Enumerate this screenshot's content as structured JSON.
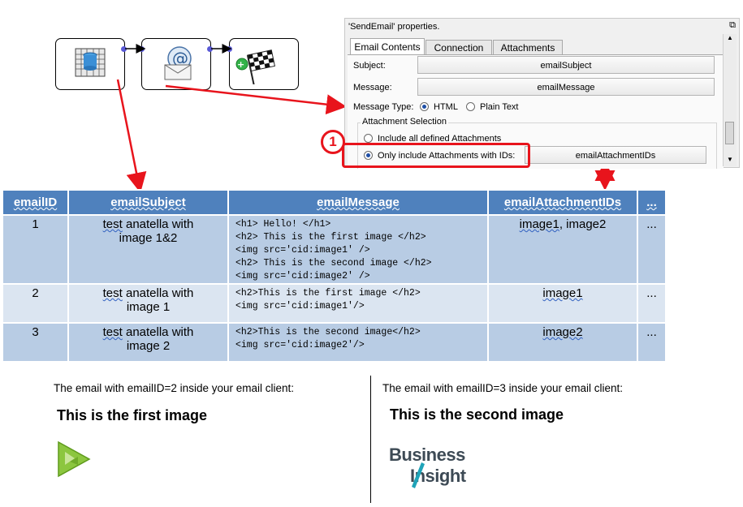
{
  "workflow": {
    "nodes": [
      {
        "name": "database-table",
        "icon": "table-database-icon"
      },
      {
        "name": "send-email",
        "icon": "email-icon"
      },
      {
        "name": "finish",
        "icon": "checkered-flag-icon"
      }
    ]
  },
  "properties": {
    "title": "'SendEmail' properties.",
    "tabs": [
      "Email Contents",
      "Connection",
      "Attachments"
    ],
    "subject_label": "Subject:",
    "subject_value": "emailSubject",
    "message_label": "Message:",
    "message_value": "emailMessage",
    "message_type_label": "Message Type:",
    "message_type_html": "HTML",
    "message_type_plain": "Plain Text",
    "attachment_group_label": "Attachment Selection",
    "attach_all_label": "Include all defined Attachments",
    "attach_ids_label": "Only include Attachments with IDs:",
    "attach_ids_value": "emailAttachmentIDs",
    "callout_number": "1"
  },
  "table": {
    "headers": [
      "emailID",
      "emailSubject",
      "emailMessage",
      "emailAttachmentIDs",
      "..."
    ],
    "rows": [
      {
        "id": "1",
        "subject_a": "test",
        "subject_b": " anatella with",
        "subject_c": "image 1&2",
        "message": [
          "<h1> Hello! </h1>",
          "<h2> This is the first image </h2>",
          "<img src='cid:image1' />",
          "<h2> This is the second image </h2>",
          "<img src='cid:image2' />"
        ],
        "attach_a": "image1",
        "attach_b": ", image2",
        "more": "..."
      },
      {
        "id": "2",
        "subject_a": "test",
        "subject_b": " anatella with",
        "subject_c": "image 1",
        "message": [
          "<h2>This is the first image </h2>",
          "<img src='cid:image1'/>"
        ],
        "attach_a": "image1",
        "more": "..."
      },
      {
        "id": "3",
        "subject_a": "test",
        "subject_b": " anatella with",
        "subject_c": "image 2",
        "message": [
          "<h2>This is the second image</h2>",
          "<img src='cid:image2'/>"
        ],
        "attach_a": "image2",
        "more": "..."
      }
    ]
  },
  "preview": {
    "left_caption": "The email with emailID=2 inside your email client:",
    "left_heading": "This is the first image",
    "left_image": "anatella-logo-icon",
    "right_caption": "The email with emailID=3 inside your email client:",
    "right_heading": "This is the second image",
    "right_logo_line1": "Business",
    "right_logo_line2": "Insight"
  },
  "colors": {
    "header_blue": "#4f81bd",
    "row_dark": "#b8cce4",
    "row_light": "#dbe5f1",
    "annotation_red": "#e8141c"
  }
}
